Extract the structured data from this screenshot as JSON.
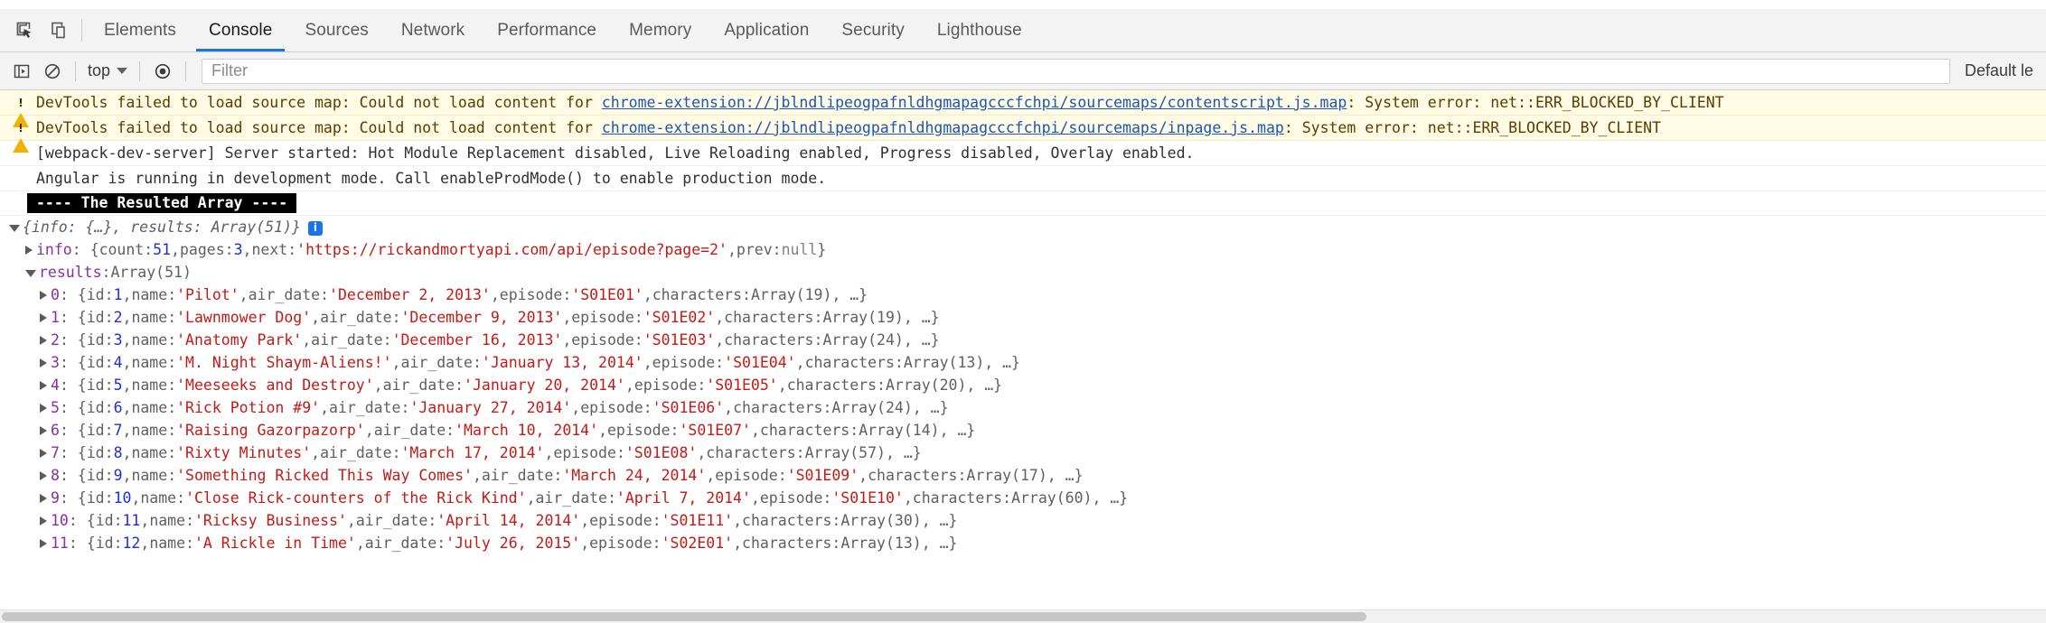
{
  "window": {
    "title": "Chrome DevTools Console"
  },
  "toolbar": {
    "inspect_icon": "inspect-element-icon",
    "device_icon": "device-toolbar-icon",
    "tabs": [
      {
        "label": "Elements",
        "active": false
      },
      {
        "label": "Console",
        "active": true
      },
      {
        "label": "Sources",
        "active": false
      },
      {
        "label": "Network",
        "active": false
      },
      {
        "label": "Performance",
        "active": false
      },
      {
        "label": "Memory",
        "active": false
      },
      {
        "label": "Application",
        "active": false
      },
      {
        "label": "Security",
        "active": false
      },
      {
        "label": "Lighthouse",
        "active": false
      }
    ]
  },
  "console_toolbar": {
    "execute_icon": "console-sidebar-icon",
    "clear_icon": "clear-console-icon",
    "context_value": "top",
    "eye_icon": "live-expression-icon",
    "filter": {
      "value": "",
      "placeholder": "Filter"
    },
    "levels_label": "Default le"
  },
  "console": {
    "messages": [
      {
        "type": "warning",
        "icon": "warning-icon",
        "prefix": "DevTools failed to load source map: Could not load content for ",
        "link": "chrome-extension://jblndlipeogpafnldhgmapagcccfchpi/sourcemaps/contentscript.js.map",
        "suffix": ": System error: net::ERR_BLOCKED_BY_CLIENT"
      },
      {
        "type": "warning",
        "icon": "warning-icon",
        "prefix": "DevTools failed to load source map: Could not load content for ",
        "link": "chrome-extension://jblndlipeogpafnldhgmapagcccfchpi/sourcemaps/inpage.js.map",
        "suffix": ": System error: net::ERR_BLOCKED_BY_CLIENT"
      },
      {
        "type": "log",
        "text": "[webpack-dev-server] Server started: Hot Module Replacement disabled, Live Reloading enabled, Progress disabled, Overlay enabled."
      },
      {
        "type": "log",
        "text": "Angular is running in development mode. Call enableProdMode() to enable production mode."
      },
      {
        "type": "banner",
        "text": "---- The Resulted Array ----"
      }
    ]
  },
  "object_tree": {
    "root": {
      "arrow": "expanded",
      "preview": "{info: {…}, results: Array(51)}",
      "info_badge": "i"
    },
    "info": {
      "arrow": "collapsed",
      "key": "info",
      "open_brace": ": {",
      "count_key": "count",
      "count_value": "51",
      "pages_key": "pages",
      "pages_value": "3",
      "next_key": "next",
      "next_value": "'https://rickandmortyapi.com/api/episode?page=2'",
      "prev_key": "prev",
      "prev_value": "null",
      "close_brace": "}"
    },
    "results_header": {
      "arrow": "expanded",
      "key": "results",
      "value": "Array(51)"
    },
    "results": [
      {
        "index": "0",
        "id": "1",
        "name": "'Pilot'",
        "air_date": "'December 2, 2013'",
        "episode": "'S01E01'",
        "characters": "Array(19)"
      },
      {
        "index": "1",
        "id": "2",
        "name": "'Lawnmower Dog'",
        "air_date": "'December 9, 2013'",
        "episode": "'S01E02'",
        "characters": "Array(19)"
      },
      {
        "index": "2",
        "id": "3",
        "name": "'Anatomy Park'",
        "air_date": "'December 16, 2013'",
        "episode": "'S01E03'",
        "characters": "Array(24)"
      },
      {
        "index": "3",
        "id": "4",
        "name": "'M. Night Shaym-Aliens!'",
        "air_date": "'January 13, 2014'",
        "episode": "'S01E04'",
        "characters": "Array(13)"
      },
      {
        "index": "4",
        "id": "5",
        "name": "'Meeseeks and Destroy'",
        "air_date": "'January 20, 2014'",
        "episode": "'S01E05'",
        "characters": "Array(20)"
      },
      {
        "index": "5",
        "id": "6",
        "name": "'Rick Potion #9'",
        "air_date": "'January 27, 2014'",
        "episode": "'S01E06'",
        "characters": "Array(24)"
      },
      {
        "index": "6",
        "id": "7",
        "name": "'Raising Gazorpazorp'",
        "air_date": "'March 10, 2014'",
        "episode": "'S01E07'",
        "characters": "Array(14)"
      },
      {
        "index": "7",
        "id": "8",
        "name": "'Rixty Minutes'",
        "air_date": "'March 17, 2014'",
        "episode": "'S01E08'",
        "characters": "Array(57)"
      },
      {
        "index": "8",
        "id": "9",
        "name": "'Something Ricked This Way Comes'",
        "air_date": "'March 24, 2014'",
        "episode": "'S01E09'",
        "characters": "Array(17)"
      },
      {
        "index": "9",
        "id": "10",
        "name": "'Close Rick-counters of the Rick Kind'",
        "air_date": "'April 7, 2014'",
        "episode": "'S01E10'",
        "characters": "Array(60)"
      },
      {
        "index": "10",
        "id": "11",
        "name": "'Ricksy Business'",
        "air_date": "'April 14, 2014'",
        "episode": "'S01E11'",
        "characters": "Array(30)"
      },
      {
        "index": "11",
        "id": "12",
        "name": "'A Rickle in Time'",
        "air_date": "'July 26, 2015'",
        "episode": "'S02E01'",
        "characters": "Array(13)"
      }
    ],
    "labels": {
      "id": "id",
      "name": "name",
      "air_date": "air_date",
      "episode": "episode",
      "characters": "characters",
      "ellipsis": "…",
      "open_brace": "{",
      "close_brace": "}"
    }
  },
  "colors": {
    "accent": "#1a73e8",
    "string": "#c41a16",
    "number": "#1a2fd4",
    "key": "#8b2fa0",
    "warning_bg": "#fffbe5",
    "warning_icon": "#f0b400",
    "banner_bg": "#000000"
  }
}
